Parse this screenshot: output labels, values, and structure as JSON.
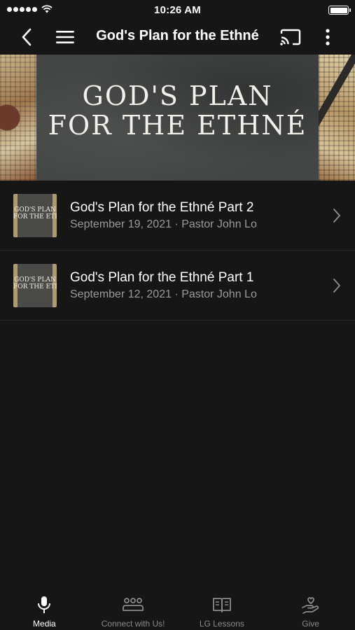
{
  "status_bar": {
    "time": "10:26 AM"
  },
  "nav": {
    "title": "God's Plan for the Ethné"
  },
  "banner": {
    "title_line1": "God's Plan",
    "title_line2": "for the ethné"
  },
  "items": [
    {
      "thumb_line1": "God's Plan",
      "thumb_line2": "for the ethn",
      "title": "God's Plan for the Ethné Part 2",
      "subtitle": "September 19, 2021 · Pastor John Lo"
    },
    {
      "thumb_line1": "God's Plan",
      "thumb_line2": "for the ethn",
      "title": "God's Plan for the Ethné Part 1",
      "subtitle": "September 12, 2021 · Pastor John Lo"
    }
  ],
  "tabs": [
    {
      "label": "Media",
      "icon": "microphone-icon",
      "active": true
    },
    {
      "label": "Connect with Us!",
      "icon": "people-icon",
      "active": false
    },
    {
      "label": "LG Lessons",
      "icon": "book-icon",
      "active": false
    },
    {
      "label": "Give",
      "icon": "hand-heart-icon",
      "active": false
    }
  ],
  "colors": {
    "background": "#161616",
    "text_primary": "#ffffff",
    "text_secondary": "#9a9a9a",
    "tab_inactive": "#8a8a8a"
  }
}
